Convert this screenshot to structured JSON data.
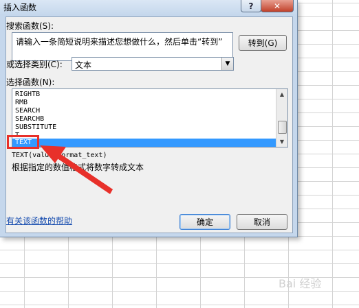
{
  "dialog": {
    "title": "插入函数",
    "help_glyph": "?",
    "close_glyph": "✕"
  },
  "search": {
    "label": "搜索函数(S):",
    "value": "请输入一条简短说明来描述您想做什么，然后单击“转到”",
    "go_button": "转到(G)"
  },
  "category": {
    "label": "或选择类别(C):",
    "value": "文本"
  },
  "functions": {
    "label": "选择函数(N):",
    "items": [
      "RIGHTB",
      "RMB",
      "SEARCH",
      "SEARCHB",
      "SUBSTITUTE",
      "T",
      "TEXT"
    ],
    "selected": "TEXT"
  },
  "details": {
    "syntax": "TEXT(value,format_text)",
    "description": "根据指定的数值格式将数字转成文本"
  },
  "footer": {
    "help_link": "有关该函数的帮助",
    "ok_button": "确定",
    "cancel_button": "取消"
  },
  "annotation": {
    "color": "#e8302a"
  },
  "watermark": "Bai 经验"
}
